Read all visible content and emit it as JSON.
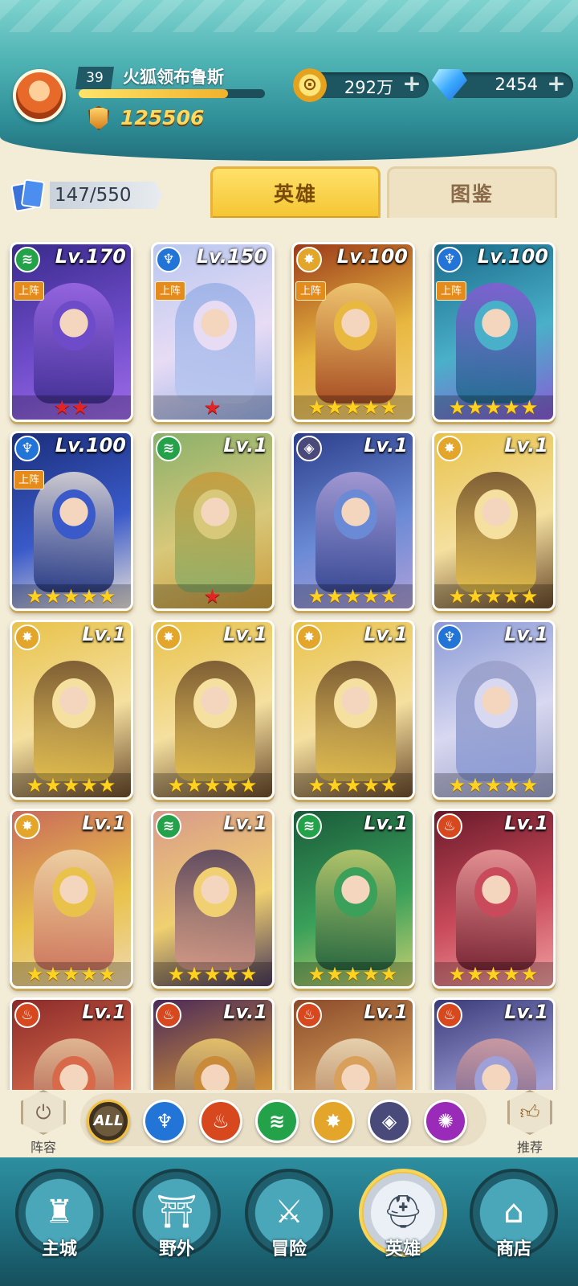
{
  "player": {
    "level": "39",
    "name": "火狐领布鲁斯",
    "power": "125506",
    "xp_fraction": 0.8
  },
  "resources": {
    "gold": "292万",
    "gems": "2454"
  },
  "hero_count": "147/550",
  "tabs": [
    {
      "label": "英雄",
      "active": true
    },
    {
      "label": "图鉴",
      "active": false
    }
  ],
  "heroes": [
    {
      "element": "wind",
      "level": "Lv.170",
      "deployed": true,
      "stars": 2,
      "star_color": "red",
      "palette": [
        "#3a2b8c",
        "#6e4cc9",
        "#9f6be8"
      ]
    },
    {
      "element": "water",
      "level": "Lv.150",
      "deployed": true,
      "stars": 1,
      "star_color": "red",
      "palette": [
        "#b9c7ef",
        "#e8dcf5",
        "#9ab0e6"
      ]
    },
    {
      "element": "light",
      "level": "Lv.100",
      "deployed": true,
      "stars": 5,
      "star_color": "gold",
      "palette": [
        "#9b3a1a",
        "#e8b840",
        "#f5d07a"
      ]
    },
    {
      "element": "water",
      "level": "Lv.100",
      "deployed": true,
      "stars": 5,
      "star_color": "gold",
      "palette": [
        "#1a6b8a",
        "#4ab0c9",
        "#8a5ad6"
      ]
    },
    {
      "element": "water",
      "level": "Lv.100",
      "deployed": true,
      "stars": 5,
      "star_color": "gold",
      "palette": [
        "#1b2e7a",
        "#3a5ac9",
        "#e8e0d8"
      ]
    },
    {
      "element": "wind",
      "level": "Lv.1",
      "deployed": false,
      "stars": 1,
      "star_color": "red",
      "palette": [
        "#8ab06a",
        "#d8c87a",
        "#c99a3a"
      ]
    },
    {
      "element": "dark",
      "level": "Lv.1",
      "deployed": false,
      "stars": 5,
      "star_color": "gold",
      "palette": [
        "#2c3e8a",
        "#6a8ad6",
        "#b0a0d8"
      ]
    },
    {
      "element": "light",
      "level": "Lv.1",
      "deployed": false,
      "stars": 5,
      "star_color": "gold",
      "palette": [
        "#e8c24a",
        "#f5e0a0",
        "#6b4a2a"
      ]
    },
    {
      "element": "light",
      "level": "Lv.1",
      "deployed": false,
      "stars": 5,
      "star_color": "gold",
      "palette": [
        "#e8c24a",
        "#f5e0a0",
        "#6b4a2a"
      ]
    },
    {
      "element": "light",
      "level": "Lv.1",
      "deployed": false,
      "stars": 5,
      "star_color": "gold",
      "palette": [
        "#e8c24a",
        "#f5e0a0",
        "#6b4a2a"
      ]
    },
    {
      "element": "light",
      "level": "Lv.1",
      "deployed": false,
      "stars": 5,
      "star_color": "gold",
      "palette": [
        "#e8c24a",
        "#f5e0a0",
        "#6b4a2a"
      ]
    },
    {
      "element": "water",
      "level": "Lv.1",
      "deployed": false,
      "stars": 5,
      "star_color": "gold",
      "palette": [
        "#8a9ad6",
        "#d8d8f0",
        "#9aa0c8"
      ]
    },
    {
      "element": "light",
      "level": "Lv.1",
      "deployed": false,
      "stars": 5,
      "star_color": "gold",
      "palette": [
        "#c96a5a",
        "#e8c24a",
        "#f0d8b0"
      ]
    },
    {
      "element": "wind",
      "level": "Lv.1",
      "deployed": false,
      "stars": 5,
      "star_color": "gold",
      "palette": [
        "#d89a8a",
        "#f0d070",
        "#4a3a5a"
      ]
    },
    {
      "element": "wind",
      "level": "Lv.1",
      "deployed": false,
      "stars": 5,
      "star_color": "gold",
      "palette": [
        "#1a5a3a",
        "#3aa05a",
        "#c8d070"
      ]
    },
    {
      "element": "fire",
      "level": "Lv.1",
      "deployed": false,
      "stars": 5,
      "star_color": "gold",
      "palette": [
        "#6a1a2a",
        "#c94a5a",
        "#f0a0a0"
      ]
    },
    {
      "element": "fire",
      "level": "Lv.1",
      "deployed": false,
      "stars": 0,
      "star_color": "gold",
      "palette": [
        "#8a2a2a",
        "#d86a4a",
        "#e8c8a0"
      ]
    },
    {
      "element": "fire",
      "level": "Lv.1",
      "deployed": false,
      "stars": 0,
      "star_color": "gold",
      "palette": [
        "#4a2a5a",
        "#c98a3a",
        "#f0d070"
      ]
    },
    {
      "element": "fire",
      "level": "Lv.1",
      "deployed": false,
      "stars": 0,
      "star_color": "gold",
      "palette": [
        "#8a4a2a",
        "#d8a05a",
        "#f0e0c0"
      ]
    },
    {
      "element": "fire",
      "level": "Lv.1",
      "deployed": false,
      "stars": 0,
      "star_color": "gold",
      "palette": [
        "#3a3a7a",
        "#a0a0d8",
        "#d8a0a0"
      ]
    }
  ],
  "deploy_label": "上阵",
  "element_icons": {
    "wind": {
      "glyph": "≋",
      "color": "#23a24a"
    },
    "water": {
      "glyph": "♆",
      "color": "#2275d6"
    },
    "light": {
      "glyph": "✸",
      "color": "#e3a52a"
    },
    "dark": {
      "glyph": "◈",
      "color": "#4a4a7a"
    },
    "fire": {
      "glyph": "♨",
      "color": "#d8481e"
    },
    "chaos": {
      "glyph": "✺",
      "color": "#9a2ab8"
    }
  },
  "filter": {
    "all_label": "ALL",
    "elements": [
      "water",
      "fire",
      "wind",
      "light",
      "dark",
      "chaos"
    ],
    "lineup_label": "阵容",
    "recommend_label": "推荐"
  },
  "nav": [
    {
      "label": "主城",
      "icon": "castle-icon",
      "glyph": "♜",
      "active": false
    },
    {
      "label": "野外",
      "icon": "gate-icon",
      "glyph": "⛩",
      "active": false
    },
    {
      "label": "冒险",
      "icon": "sword-icon",
      "glyph": "⚔",
      "active": false
    },
    {
      "label": "英雄",
      "icon": "helmet-icon",
      "glyph": "⛑",
      "active": true
    },
    {
      "label": "商店",
      "icon": "shop-icon",
      "glyph": "⌂",
      "active": false
    }
  ]
}
